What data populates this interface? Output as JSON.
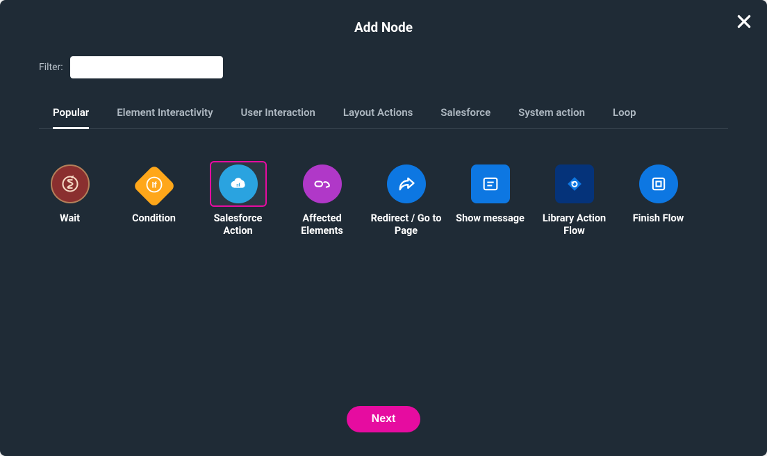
{
  "modal": {
    "title": "Add Node",
    "filter_label": "Filter:",
    "filter_value": "",
    "filter_placeholder": ""
  },
  "tabs": [
    {
      "label": "Popular",
      "active": true
    },
    {
      "label": "Element Interactivity",
      "active": false
    },
    {
      "label": "User Interaction",
      "active": false
    },
    {
      "label": "Layout Actions",
      "active": false
    },
    {
      "label": "Salesforce",
      "active": false
    },
    {
      "label": "System action",
      "active": false
    },
    {
      "label": "Loop",
      "active": false
    }
  ],
  "nodes": [
    {
      "id": "wait",
      "label": "Wait",
      "icon": "hourglass-icon",
      "shape": "circle",
      "color": "bg-wait",
      "selected": false
    },
    {
      "id": "condition",
      "label": "Condition",
      "icon": "if-icon",
      "shape": "diamond",
      "color": "bg-cond",
      "selected": false
    },
    {
      "id": "salesforce-action",
      "label": "Salesforce Action",
      "icon": "cloud-sf-icon",
      "shape": "circle",
      "color": "bg-sf",
      "selected": true
    },
    {
      "id": "affected-elements",
      "label": "Affected Elements",
      "icon": "hand-bar-icon",
      "shape": "circle",
      "color": "bg-aff",
      "selected": false
    },
    {
      "id": "redirect-page",
      "label": "Redirect / Go to Page",
      "icon": "share-arrow-icon",
      "shape": "circle",
      "color": "bg-blue",
      "selected": false
    },
    {
      "id": "show-message",
      "label": "Show message",
      "icon": "message-lines-icon",
      "shape": "square",
      "color": "bg-blue",
      "selected": false
    },
    {
      "id": "library-action-flow",
      "label": "Library Action Flow",
      "icon": "refresh-diamond-icon",
      "shape": "square",
      "color": "bg-navy",
      "selected": false
    },
    {
      "id": "finish-flow",
      "label": "Finish Flow",
      "icon": "stop-square-icon",
      "shape": "circle",
      "color": "bg-blue",
      "selected": false
    }
  ],
  "footer": {
    "next_label": "Next"
  }
}
